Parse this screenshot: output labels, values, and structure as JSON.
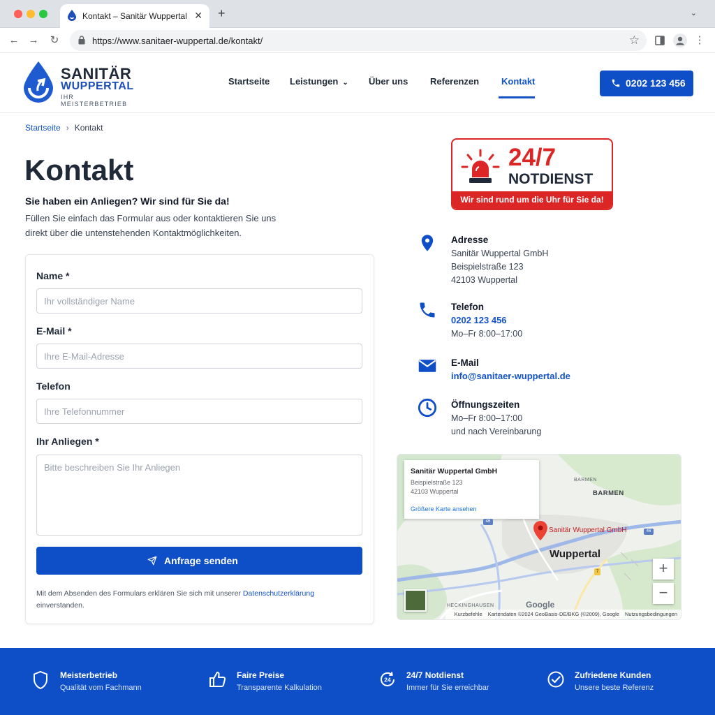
{
  "browser": {
    "tab_title": "Kontakt – Sanitär Wuppertal",
    "url": "https://www.sanitaer-wuppertal.de/kontakt/"
  },
  "header": {
    "logo": {
      "line1": "SANITÄR",
      "line2": "WUPPERTAL",
      "tagline": "IHR MEISTERBETRIEB"
    },
    "nav": [
      "Startseite",
      "Leistungen",
      "Über uns",
      "Referenzen",
      "Kontakt"
    ],
    "active_nav": "Kontakt",
    "phone_button": "0202 123 456"
  },
  "breadcrumb": {
    "home": "Startseite",
    "separator": "›",
    "current": "Kontakt"
  },
  "page": {
    "title": "Kontakt",
    "lead": "Sie haben ein Anliegen? Wir sind für Sie da!",
    "intro_line1": "Füllen Sie einfach das Formular aus oder kontaktieren Sie uns",
    "intro_line2": "direkt über die untenstehenden Kontaktmöglichkeiten."
  },
  "form": {
    "name_label": "Name *",
    "name_placeholder": "Ihr vollständiger Name",
    "email_label": "E-Mail *",
    "email_placeholder": "Ihre E-Mail-Adresse",
    "phone_label": "Telefon",
    "phone_placeholder": "Ihre Telefonnummer",
    "message_label": "Ihr Anliegen *",
    "message_placeholder": "Bitte beschreiben Sie Ihr Anliegen",
    "submit": "Anfrage senden",
    "privacy_before": "Mit dem Absenden des Formulars erklären Sie sich mit unserer",
    "privacy_link": "Datenschutzerklärung",
    "privacy_after": "einverstanden."
  },
  "notdienst": {
    "big": "24/7",
    "word": "NOTDIENST",
    "strip": "Wir sind rund um die Uhr für Sie da!"
  },
  "contact": {
    "address": {
      "title": "Adresse",
      "company": "Sanitär Wuppertal GmbH",
      "street": "Beispielstraße 123",
      "city": "42103 Wuppertal"
    },
    "phone": {
      "title": "Telefon",
      "number": "0202 123 456",
      "hours": "Mo–Fr 8:00–17:00"
    },
    "email": {
      "title": "E-Mail",
      "address": "info@sanitaer-wuppertal.de"
    },
    "hours": {
      "title": "Öffnungszeiten",
      "line1": "Mo–Fr 8:00–17:00",
      "line2": "und nach Vereinbarung"
    }
  },
  "map": {
    "card_title": "Sanitär Wuppertal GmbH",
    "card_street": "Beispielstraße 123",
    "card_city": "42103 Wuppertal",
    "card_link": "Größere Karte ansehen",
    "pin_label": "Sanitär Wuppertal GmbH",
    "city": "Wuppertal",
    "district": "BARMEN",
    "district_small": "BARMEN",
    "district_heck": "HECKINGHAUSEN",
    "highway_46": "46",
    "highway_7": "7",
    "zoom_in": "+",
    "zoom_out": "−",
    "google": "Google",
    "attr_shortcuts": "Kurzbefehle",
    "attr_data": "Kartendaten ©2024 GeoBasis-DE/BKG (©2009), Google",
    "attr_terms": "Nutzungsbedingungen"
  },
  "features": [
    {
      "title": "Meisterbetrieb",
      "sub": "Qualität vom Fachmann",
      "icon": "shield-icon"
    },
    {
      "title": "Faire Preise",
      "sub": "Transparente Kalkulation",
      "icon": "thumbs-up-icon"
    },
    {
      "title": "24/7 Notdienst",
      "sub": "Immer für Sie erreichbar",
      "icon": "clock-24-icon",
      "icon_text": "24"
    },
    {
      "title": "Zufriedene Kunden",
      "sub": "Unsere beste Referenz",
      "icon": "check-circle-icon"
    }
  ],
  "colors": {
    "brand_blue": "#0e4ec7",
    "emergency_red": "#dc2626",
    "text_dark": "#1f2937"
  }
}
